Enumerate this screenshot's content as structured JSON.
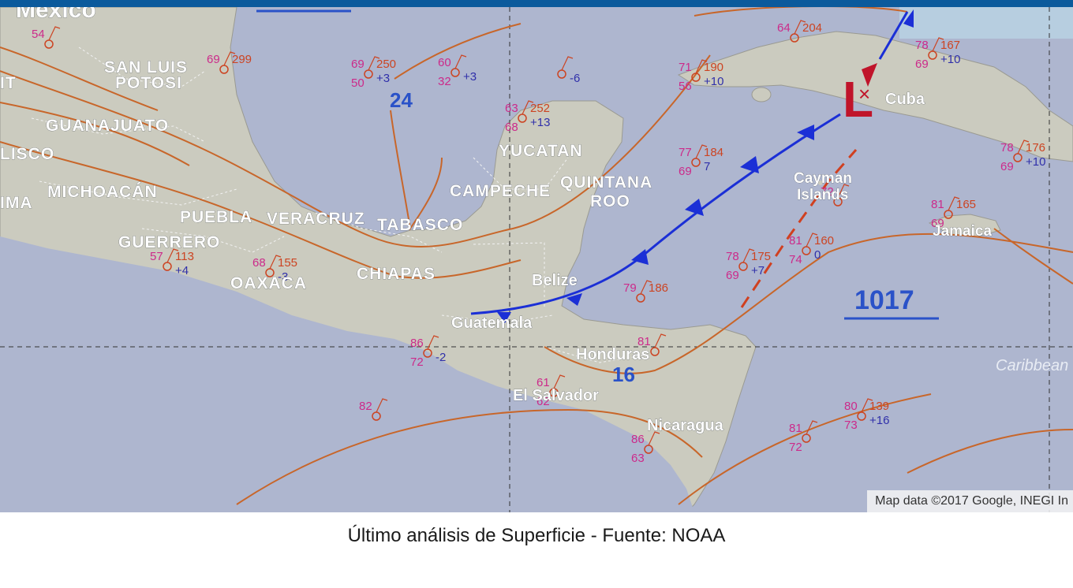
{
  "page": {
    "caption": "Último análisis de Superficie - Fuente: NOAA",
    "attribution": "Map data ©2017 Google, INEGI In"
  },
  "map": {
    "countries": [
      "Mexico",
      "Belize",
      "Guatemala",
      "Honduras",
      "El Salvador",
      "Nicaragua",
      "Cuba",
      "Jamaica"
    ],
    "regions": [
      "SAN LUIS",
      "POTOSI",
      "GUANAJUATO",
      "LISCO",
      "MICHOACÁN",
      "IMA",
      "PUEBLA",
      "VERACRUZ",
      "TABASCO",
      "GUERRERO",
      "OAXACA",
      "CHIAPAS",
      "CAMPECHE",
      "YUCATAN",
      "QUINTANA",
      "ROO",
      "Cayman",
      "Islands",
      "IT"
    ],
    "sea": "Caribbean",
    "pressure": {
      "low_symbol": "L",
      "low_center": "Cuba",
      "high_value": "1017",
      "isobar_labels": [
        "24",
        "16"
      ]
    },
    "colors": {
      "land": "#c9c9bd",
      "sea": "#aeb6cf",
      "cold_front": "#1b2fd6",
      "isobar": "#c8662a",
      "station_red": "#cc4422",
      "temperature": "#cc2a8a",
      "dewpoint": "#2a2ab0",
      "tendency": "#3030aa",
      "low_marker": "#c0142a",
      "trough": "#d04020"
    },
    "stations": [
      {
        "t": "54",
        "d": "",
        "p": "",
        "tend": ""
      },
      {
        "t": "69",
        "d": "",
        "p": "299",
        "tend": ""
      },
      {
        "t": "60",
        "d": "32",
        "p": "",
        "tend": "+3"
      },
      {
        "t": "69",
        "d": "50",
        "p": "250",
        "tend": "+3"
      },
      {
        "t": "",
        "d": "",
        "p": "",
        "tend": "-6"
      },
      {
        "t": "63",
        "d": "68",
        "p": "252",
        "tend": "+13"
      },
      {
        "t": "71",
        "d": "56",
        "p": "190",
        "tend": "+10"
      },
      {
        "t": "64",
        "d": "",
        "p": "204",
        "tend": ""
      },
      {
        "t": "78",
        "d": "69",
        "p": "167",
        "tend": "+10"
      },
      {
        "t": "77",
        "d": "69",
        "p": "184",
        "tend": "7"
      },
      {
        "t": "78",
        "d": "69",
        "p": "176",
        "tend": "+10"
      },
      {
        "t": "81",
        "d": "69",
        "p": "165",
        "tend": ""
      },
      {
        "t": "81",
        "d": "74",
        "p": "160",
        "tend": "0"
      },
      {
        "t": "78",
        "d": "69",
        "p": "175",
        "tend": "+7"
      },
      {
        "t": "79",
        "d": "",
        "p": "186",
        "tend": ""
      },
      {
        "t": "80",
        "d": "73",
        "p": "139",
        "tend": "+16"
      },
      {
        "t": "81",
        "d": "72",
        "p": "",
        "tend": ""
      },
      {
        "t": "82",
        "d": "",
        "p": "",
        "tend": ""
      },
      {
        "t": "86",
        "d": "72",
        "p": "",
        "tend": "-2"
      },
      {
        "t": "57",
        "d": "",
        "p": "113",
        "tend": "+4"
      },
      {
        "t": "68",
        "d": "",
        "p": "155",
        "tend": "-3"
      },
      {
        "t": "72",
        "d": "",
        "p": "",
        "tend": ""
      },
      {
        "t": "81",
        "d": "",
        "p": "",
        "tend": ""
      },
      {
        "t": "86",
        "d": "63",
        "p": "",
        "tend": ""
      },
      {
        "t": "61",
        "d": "62",
        "p": "",
        "tend": ""
      }
    ]
  }
}
